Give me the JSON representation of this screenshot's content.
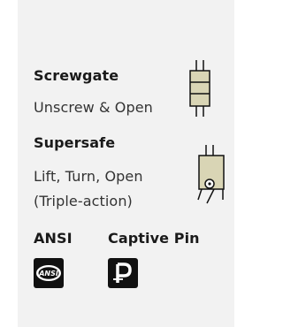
{
  "sections": {
    "screwgate": {
      "title": "Screwgate",
      "description": "Unscrew & Open"
    },
    "supersafe": {
      "title": "Supersafe",
      "description_line1": "Lift, Turn, Open",
      "description_line2": "(Triple-action)"
    },
    "ansi": {
      "title": "ANSI",
      "badge_text": "ANSI"
    },
    "captive_pin": {
      "title": "Captive Pin"
    }
  },
  "colors": {
    "panel_background": "#f2f2f2",
    "title_text": "#1a1a1a",
    "body_text": "#333333",
    "illustration_fill": "#d9d5b5",
    "badge_background": "#111111"
  },
  "icons": [
    "screwgate-lock-icon",
    "supersafe-lock-icon",
    "ansi-badge-icon",
    "captive-pin-icon"
  ]
}
